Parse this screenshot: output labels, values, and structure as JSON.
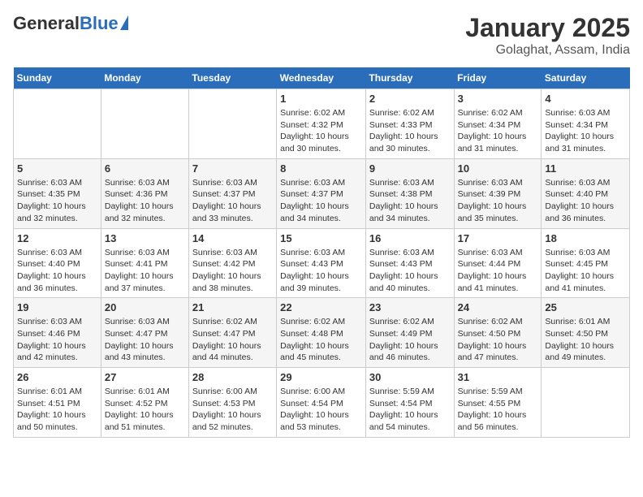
{
  "header": {
    "logo_general": "General",
    "logo_blue": "Blue",
    "title": "January 2025",
    "subtitle": "Golaghat, Assam, India"
  },
  "weekdays": [
    "Sunday",
    "Monday",
    "Tuesday",
    "Wednesday",
    "Thursday",
    "Friday",
    "Saturday"
  ],
  "weeks": [
    [
      {
        "num": "",
        "info": ""
      },
      {
        "num": "",
        "info": ""
      },
      {
        "num": "",
        "info": ""
      },
      {
        "num": "1",
        "info": "Sunrise: 6:02 AM\nSunset: 4:32 PM\nDaylight: 10 hours and 30 minutes."
      },
      {
        "num": "2",
        "info": "Sunrise: 6:02 AM\nSunset: 4:33 PM\nDaylight: 10 hours and 30 minutes."
      },
      {
        "num": "3",
        "info": "Sunrise: 6:02 AM\nSunset: 4:34 PM\nDaylight: 10 hours and 31 minutes."
      },
      {
        "num": "4",
        "info": "Sunrise: 6:03 AM\nSunset: 4:34 PM\nDaylight: 10 hours and 31 minutes."
      }
    ],
    [
      {
        "num": "5",
        "info": "Sunrise: 6:03 AM\nSunset: 4:35 PM\nDaylight: 10 hours and 32 minutes."
      },
      {
        "num": "6",
        "info": "Sunrise: 6:03 AM\nSunset: 4:36 PM\nDaylight: 10 hours and 32 minutes."
      },
      {
        "num": "7",
        "info": "Sunrise: 6:03 AM\nSunset: 4:37 PM\nDaylight: 10 hours and 33 minutes."
      },
      {
        "num": "8",
        "info": "Sunrise: 6:03 AM\nSunset: 4:37 PM\nDaylight: 10 hours and 34 minutes."
      },
      {
        "num": "9",
        "info": "Sunrise: 6:03 AM\nSunset: 4:38 PM\nDaylight: 10 hours and 34 minutes."
      },
      {
        "num": "10",
        "info": "Sunrise: 6:03 AM\nSunset: 4:39 PM\nDaylight: 10 hours and 35 minutes."
      },
      {
        "num": "11",
        "info": "Sunrise: 6:03 AM\nSunset: 4:40 PM\nDaylight: 10 hours and 36 minutes."
      }
    ],
    [
      {
        "num": "12",
        "info": "Sunrise: 6:03 AM\nSunset: 4:40 PM\nDaylight: 10 hours and 36 minutes."
      },
      {
        "num": "13",
        "info": "Sunrise: 6:03 AM\nSunset: 4:41 PM\nDaylight: 10 hours and 37 minutes."
      },
      {
        "num": "14",
        "info": "Sunrise: 6:03 AM\nSunset: 4:42 PM\nDaylight: 10 hours and 38 minutes."
      },
      {
        "num": "15",
        "info": "Sunrise: 6:03 AM\nSunset: 4:43 PM\nDaylight: 10 hours and 39 minutes."
      },
      {
        "num": "16",
        "info": "Sunrise: 6:03 AM\nSunset: 4:43 PM\nDaylight: 10 hours and 40 minutes."
      },
      {
        "num": "17",
        "info": "Sunrise: 6:03 AM\nSunset: 4:44 PM\nDaylight: 10 hours and 41 minutes."
      },
      {
        "num": "18",
        "info": "Sunrise: 6:03 AM\nSunset: 4:45 PM\nDaylight: 10 hours and 41 minutes."
      }
    ],
    [
      {
        "num": "19",
        "info": "Sunrise: 6:03 AM\nSunset: 4:46 PM\nDaylight: 10 hours and 42 minutes."
      },
      {
        "num": "20",
        "info": "Sunrise: 6:03 AM\nSunset: 4:47 PM\nDaylight: 10 hours and 43 minutes."
      },
      {
        "num": "21",
        "info": "Sunrise: 6:02 AM\nSunset: 4:47 PM\nDaylight: 10 hours and 44 minutes."
      },
      {
        "num": "22",
        "info": "Sunrise: 6:02 AM\nSunset: 4:48 PM\nDaylight: 10 hours and 45 minutes."
      },
      {
        "num": "23",
        "info": "Sunrise: 6:02 AM\nSunset: 4:49 PM\nDaylight: 10 hours and 46 minutes."
      },
      {
        "num": "24",
        "info": "Sunrise: 6:02 AM\nSunset: 4:50 PM\nDaylight: 10 hours and 47 minutes."
      },
      {
        "num": "25",
        "info": "Sunrise: 6:01 AM\nSunset: 4:50 PM\nDaylight: 10 hours and 49 minutes."
      }
    ],
    [
      {
        "num": "26",
        "info": "Sunrise: 6:01 AM\nSunset: 4:51 PM\nDaylight: 10 hours and 50 minutes."
      },
      {
        "num": "27",
        "info": "Sunrise: 6:01 AM\nSunset: 4:52 PM\nDaylight: 10 hours and 51 minutes."
      },
      {
        "num": "28",
        "info": "Sunrise: 6:00 AM\nSunset: 4:53 PM\nDaylight: 10 hours and 52 minutes."
      },
      {
        "num": "29",
        "info": "Sunrise: 6:00 AM\nSunset: 4:54 PM\nDaylight: 10 hours and 53 minutes."
      },
      {
        "num": "30",
        "info": "Sunrise: 5:59 AM\nSunset: 4:54 PM\nDaylight: 10 hours and 54 minutes."
      },
      {
        "num": "31",
        "info": "Sunrise: 5:59 AM\nSunset: 4:55 PM\nDaylight: 10 hours and 56 minutes."
      },
      {
        "num": "",
        "info": ""
      }
    ]
  ]
}
